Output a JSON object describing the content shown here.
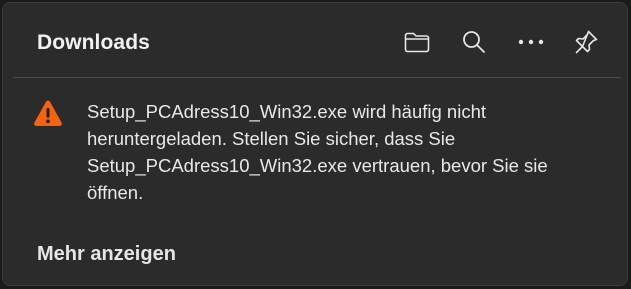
{
  "panel": {
    "title": "Downloads",
    "toolbar": {
      "folder_icon": "folder-icon",
      "search_icon": "search-icon",
      "more_icon": "more-options-icon",
      "pin_icon": "pin-icon"
    }
  },
  "warning": {
    "icon": "warning-icon",
    "icon_color": "#f7630c",
    "lines": [
      "Setup_PCAdress10_Win32.exe wird häufig nicht",
      "heruntergeladen. Stellen Sie sicher, dass Sie",
      "Setup_PCAdress10_Win32.exe vertrauen, bevor Sie sie",
      "öffnen."
    ]
  },
  "footer": {
    "show_more_label": "Mehr anzeigen"
  }
}
